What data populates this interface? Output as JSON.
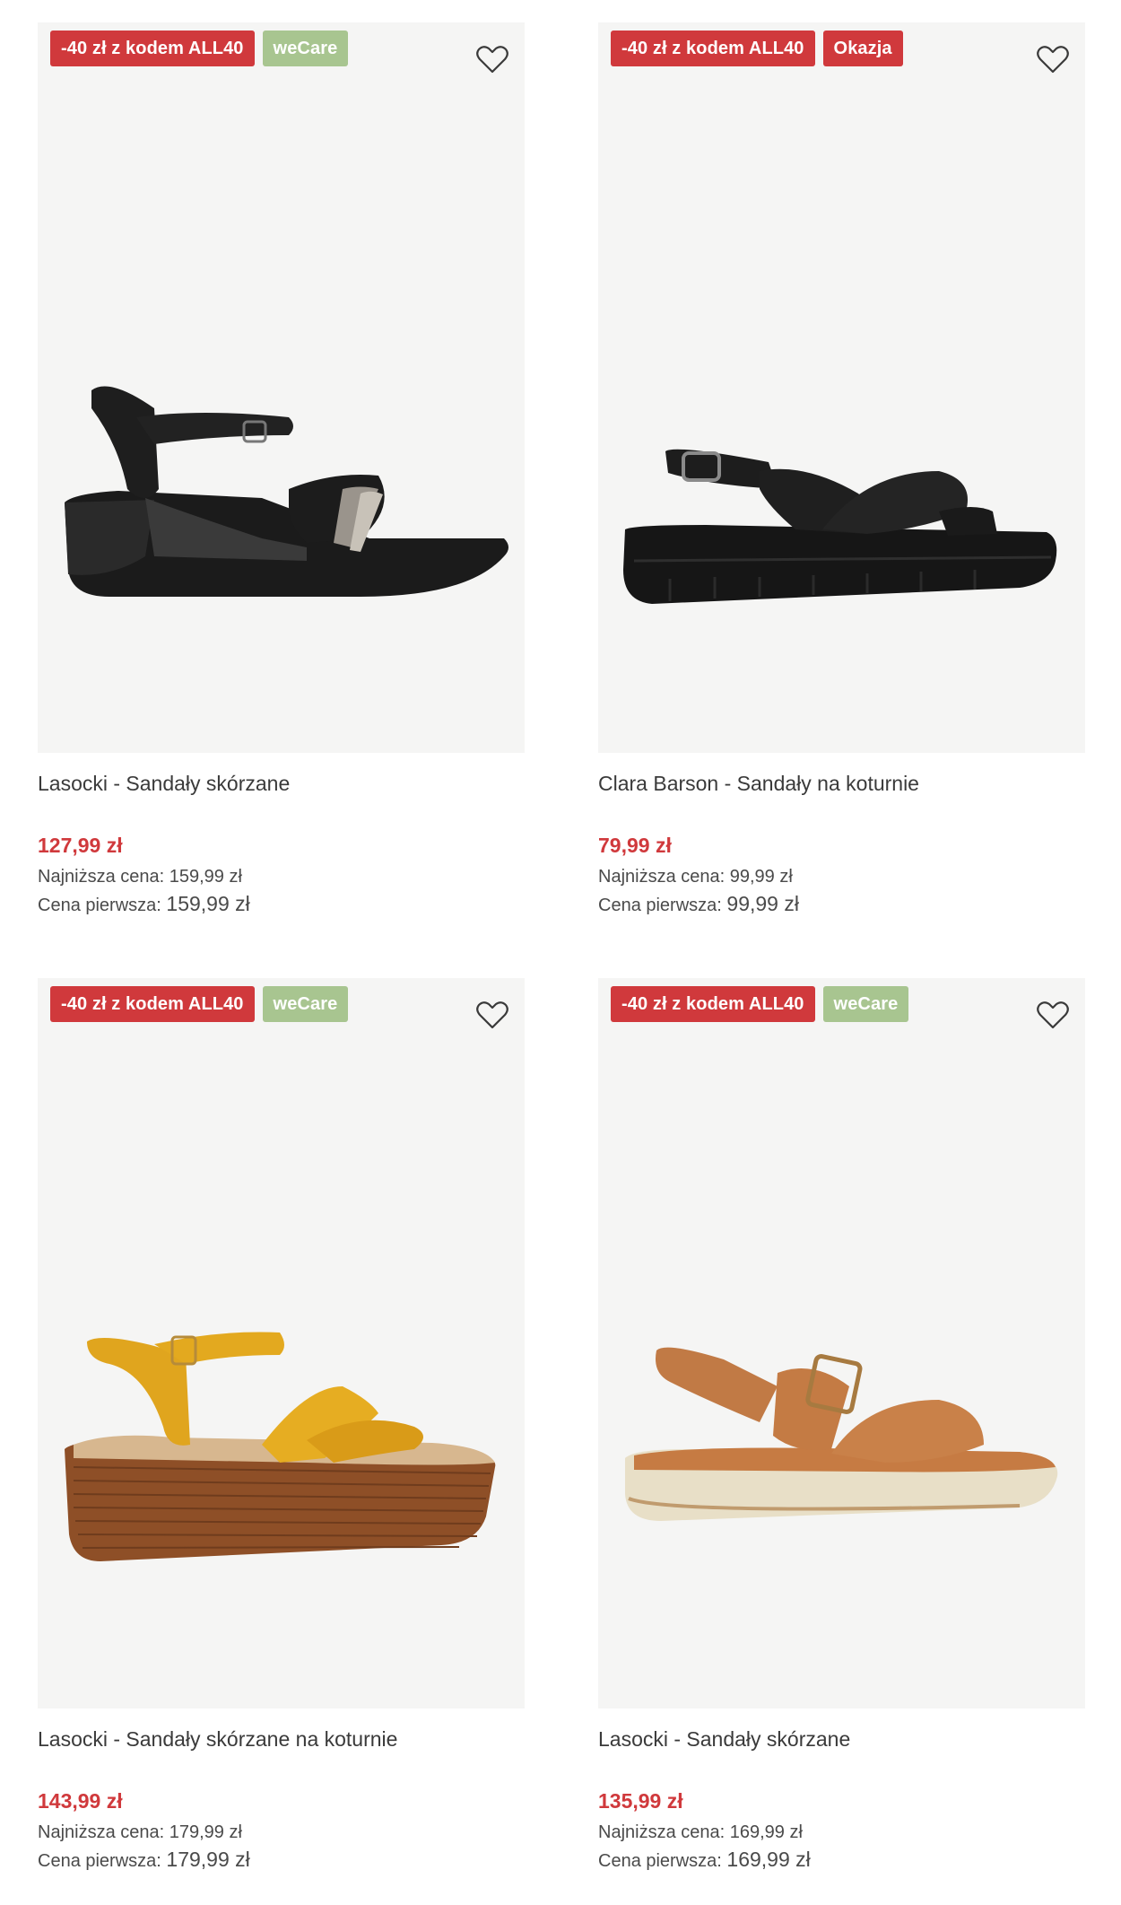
{
  "products": [
    {
      "badges": [
        {
          "label": "-40 zł z kodem ALL40",
          "kind": "promo"
        },
        {
          "label": "weCare",
          "kind": "wecare"
        }
      ],
      "name": "Lasocki - Sandały skórzane",
      "price": "127,99 zł",
      "lowest_label": "Najniższa cena:",
      "lowest_value": "159,99 zł",
      "original_label": "Cena pierwsza:",
      "original_value": "159,99 zł",
      "shoe_icon": "black-wedge-sandal"
    },
    {
      "badges": [
        {
          "label": "-40 zł z kodem ALL40",
          "kind": "promo"
        },
        {
          "label": "Okazja",
          "kind": "okazja"
        }
      ],
      "name": "Clara Barson - Sandały na koturnie",
      "price": "79,99 zł",
      "lowest_label": "Najniższa cena:",
      "lowest_value": "99,99 zł",
      "original_label": "Cena pierwsza:",
      "original_value": "99,99 zł",
      "shoe_icon": "black-platform-cross-sandal"
    },
    {
      "badges": [
        {
          "label": "-40 zł z kodem ALL40",
          "kind": "promo"
        },
        {
          "label": "weCare",
          "kind": "wecare"
        }
      ],
      "name": "Lasocki - Sandały skórzane na koturnie",
      "price": "143,99 zł",
      "lowest_label": "Najniższa cena:",
      "lowest_value": "179,99 zł",
      "original_label": "Cena pierwsza:",
      "original_value": "179,99 zł",
      "shoe_icon": "yellow-wooden-wedge-sandal"
    },
    {
      "badges": [
        {
          "label": "-40 zł z kodem ALL40",
          "kind": "promo"
        },
        {
          "label": "weCare",
          "kind": "wecare"
        }
      ],
      "name": "Lasocki - Sandały skórzane",
      "price": "135,99 zł",
      "lowest_label": "Najniższa cena:",
      "lowest_value": "169,99 zł",
      "original_label": "Cena pierwsza:",
      "original_value": "169,99 zł",
      "shoe_icon": "tan-flatform-buckle-sandal"
    }
  ],
  "colors": {
    "promo": "#d0393c",
    "wecare": "#a8c590",
    "price": "#d0393c",
    "image_bg": "#f5f5f4"
  },
  "icons": {
    "favorite": "heart-outline-icon"
  }
}
